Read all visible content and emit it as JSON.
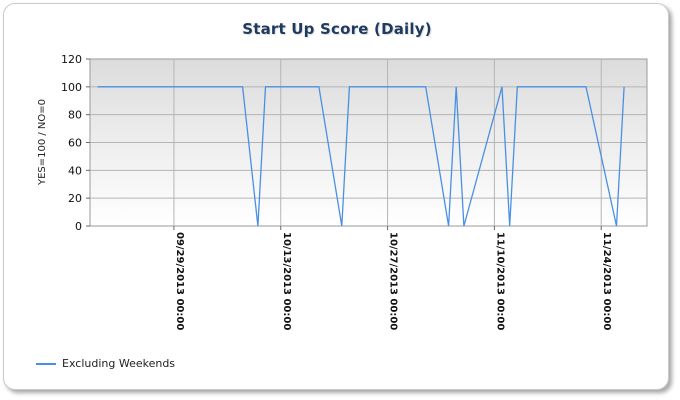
{
  "chart_data": {
    "type": "line",
    "title": "Start Up Score (Daily)",
    "xlabel": "",
    "ylabel": "YES=100 / NO=0",
    "ylim": [
      0,
      120
    ],
    "yticks": [
      0,
      20,
      40,
      60,
      80,
      100,
      120
    ],
    "xlim": [
      "2013-09-18",
      "2013-11-30"
    ],
    "xticks": [
      "2013-09-29",
      "2013-10-13",
      "2013-10-27",
      "2013-11-10",
      "2013-11-24"
    ],
    "xtick_labels": [
      "09/29/2013 00:00",
      "10/13/2013 00:00",
      "10/27/2013 00:00",
      "11/10/2013 00:00",
      "11/24/2013 00:00"
    ],
    "grid": true,
    "legend_position": "bottom-left",
    "series": [
      {
        "name": "Excluding Weekends",
        "color": "#4a90e2",
        "x": [
          "2013-09-19",
          "2013-10-08",
          "2013-10-10",
          "2013-10-11",
          "2013-10-18",
          "2013-10-21",
          "2013-10-22",
          "2013-11-01",
          "2013-11-04",
          "2013-11-05",
          "2013-11-06",
          "2013-11-11",
          "2013-11-12",
          "2013-11-13",
          "2013-11-22",
          "2013-11-26",
          "2013-11-27"
        ],
        "values": [
          100,
          100,
          0,
          100,
          100,
          0,
          100,
          100,
          0,
          100,
          0,
          100,
          0,
          100,
          100,
          0,
          100
        ]
      }
    ]
  }
}
